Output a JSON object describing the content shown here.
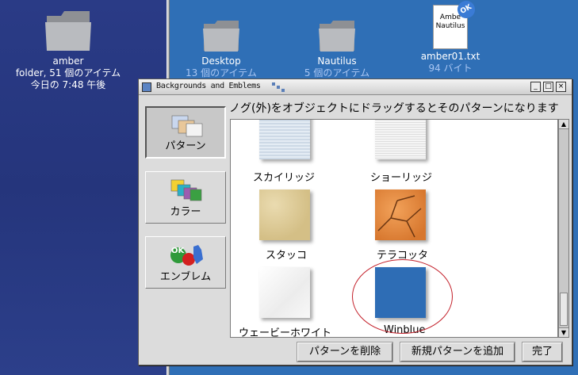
{
  "desktop": {
    "left_icon": {
      "name": "amber",
      "line2": "folder, 51 個のアイテム",
      "line3": "今日の 7:48 午後"
    },
    "icons": [
      {
        "name": "Desktop",
        "sub": "13 個のアイテム"
      },
      {
        "name": "Nautilus",
        "sub": "5 個のアイテム"
      },
      {
        "name": "amber01.txt",
        "sub": "94 バイト",
        "preview_line1": "Ambe",
        "preview_line2": "Nautilus",
        "badge": "OK"
      }
    ]
  },
  "window": {
    "title": "Backgrounds and Emblems",
    "controls": {
      "minimize": "_",
      "maximize": "□",
      "close": "×"
    },
    "hint": "ノグ(外)をオブジェクトにドラッグするとそのパターンになります"
  },
  "sidebar": {
    "items": [
      {
        "label": "パターン",
        "icon": "patterns-icon",
        "active": true
      },
      {
        "label": "カラー",
        "icon": "colors-icon",
        "active": false
      },
      {
        "label": "エンブレム",
        "icon": "emblems-icon",
        "active": false
      }
    ],
    "emblem_badge": "OK"
  },
  "patterns": [
    {
      "name": "スカイリッジ"
    },
    {
      "name": "ショーリッジ"
    },
    {
      "name": "スタッコ"
    },
    {
      "name": "テラコッタ"
    },
    {
      "name": "ウェービーホワイト"
    },
    {
      "name": "Winblue"
    }
  ],
  "buttons": {
    "delete": "パターンを削除",
    "add": "新規パターンを追加",
    "done": "完了"
  },
  "colors": {
    "desktop_blue": "#2f6fb6",
    "left_navy": "#2a3b86",
    "highlight": "#c3202a"
  }
}
